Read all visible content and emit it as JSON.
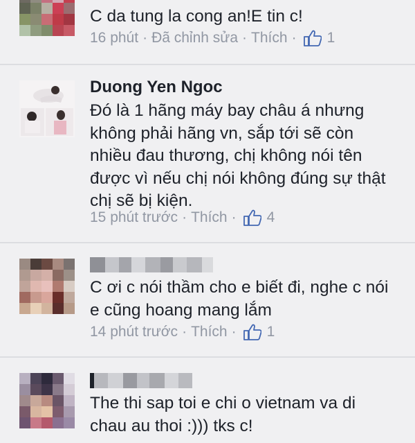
{
  "comments": [
    {
      "text": "C da tung la cong an!E tin c!",
      "meta": {
        "time": "16 phút",
        "edited": "Đã chỉnh sửa",
        "like": "Thích",
        "likes": "1"
      }
    },
    {
      "author": "Duong Yen Ngoc",
      "text": "Đó là 1 hãng máy bay châu á nhưng không phải hãng vn, sắp tới sẽ còn nhiều đau thương, chị không nói tên được vì nếu chị nói không đúng sự thật chị sẽ bị kiện.",
      "meta": {
        "time": "15 phút trước",
        "like": "Thích",
        "likes": "4"
      }
    },
    {
      "text": "C ơi c nói thầm cho e biết đi, nghe c nói e cũng hoang mang lắm",
      "meta": {
        "time": "14 phút trước",
        "like": "Thích",
        "likes": "1"
      }
    },
    {
      "text": "The thi sap toi e chi o vietnam va di chau au thoi :))) tks c!"
    }
  ],
  "colors": {
    "background": "#f0f0f2",
    "text": "#1d2129",
    "meta": "#9197a3",
    "like_blue": "#4267b2"
  },
  "icons": {
    "like": "thumbs-up-icon"
  },
  "separator": "·"
}
